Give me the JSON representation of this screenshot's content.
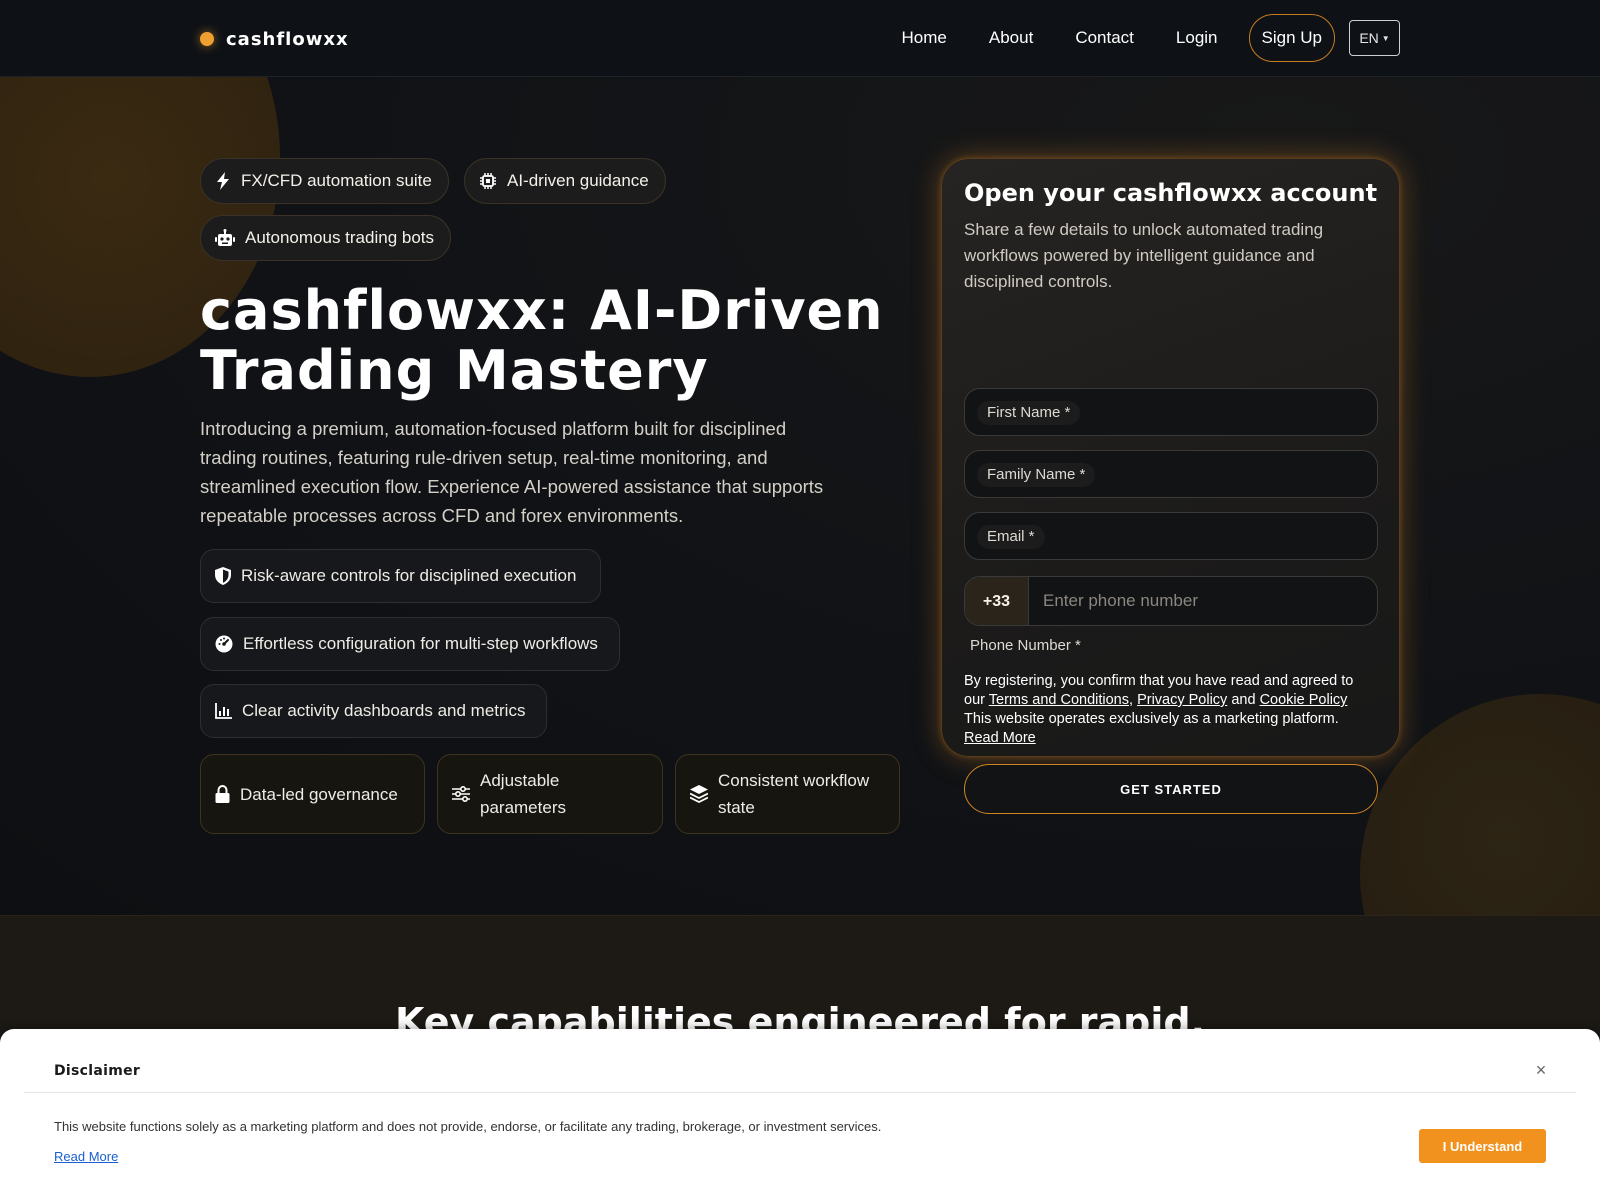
{
  "brand": {
    "name": "cashflowxx",
    "accent": "#f0a030"
  },
  "nav": {
    "items": [
      "Home",
      "About",
      "Contact",
      "Login"
    ],
    "signup": "Sign Up",
    "language": "EN"
  },
  "hero": {
    "badges": [
      {
        "icon": "lightning-icon",
        "label": "FX/CFD automation suite"
      },
      {
        "icon": "chip-icon",
        "label": "AI-driven guidance"
      },
      {
        "icon": "robot-icon",
        "label": "Autonomous trading bots"
      }
    ],
    "title_line1": "cashflowxx: AI-Driven",
    "title_line2": "Trading Mastery",
    "description": "Introducing a premium, automation-focused platform built for disciplined trading routines, featuring rule-driven setup, real-time monitoring, and streamlined execution flow. Experience AI-powered assistance that supports repeatable processes across CFD and forex environments.",
    "features": [
      {
        "icon": "shield-icon",
        "label": "Risk-aware controls for disciplined execution"
      },
      {
        "icon": "gauge-icon",
        "label": "Effortless configuration for multi-step workflows"
      },
      {
        "icon": "bar-chart-icon",
        "label": "Clear activity dashboards and metrics"
      }
    ],
    "tiles": [
      {
        "icon": "lock-icon",
        "label": "Data-led governance"
      },
      {
        "icon": "sliders-icon",
        "label": "Adjustable parameters"
      },
      {
        "icon": "layers-icon",
        "label": "Consistent workflow state"
      }
    ]
  },
  "form": {
    "title": "Open your cashflowxx account",
    "subtitle": "Share a few details to unlock automated trading workflows powered by intelligent guidance and disciplined controls.",
    "first_name_label": "First Name *",
    "family_name_label": "Family Name *",
    "email_label": "Email *",
    "phone_code": "+33",
    "phone_placeholder": "Enter phone number",
    "phone_label": "Phone Number *",
    "legal_prefix": "By registering, you confirm that you have read and agreed to our",
    "terms_link": "Terms and Conditions",
    "sep1": ",",
    "privacy_link": "Privacy Policy",
    "and_word": "and",
    "cookie_link": "Cookie Policy",
    "legal_notice": "This website operates exclusively as a marketing platform.",
    "read_more": "Read More",
    "submit": "GET STARTED"
  },
  "capabilities": {
    "heading": "Key capabilities engineered for rapid,"
  },
  "disclaimer": {
    "title": "Disclaimer",
    "close": "×",
    "text": "This website functions solely as a marketing platform and does not provide, endorse, or facilitate any trading, brokerage, or investment services.",
    "read_more": "Read More",
    "button": "I Understand",
    "button_color": "#f0921d"
  }
}
